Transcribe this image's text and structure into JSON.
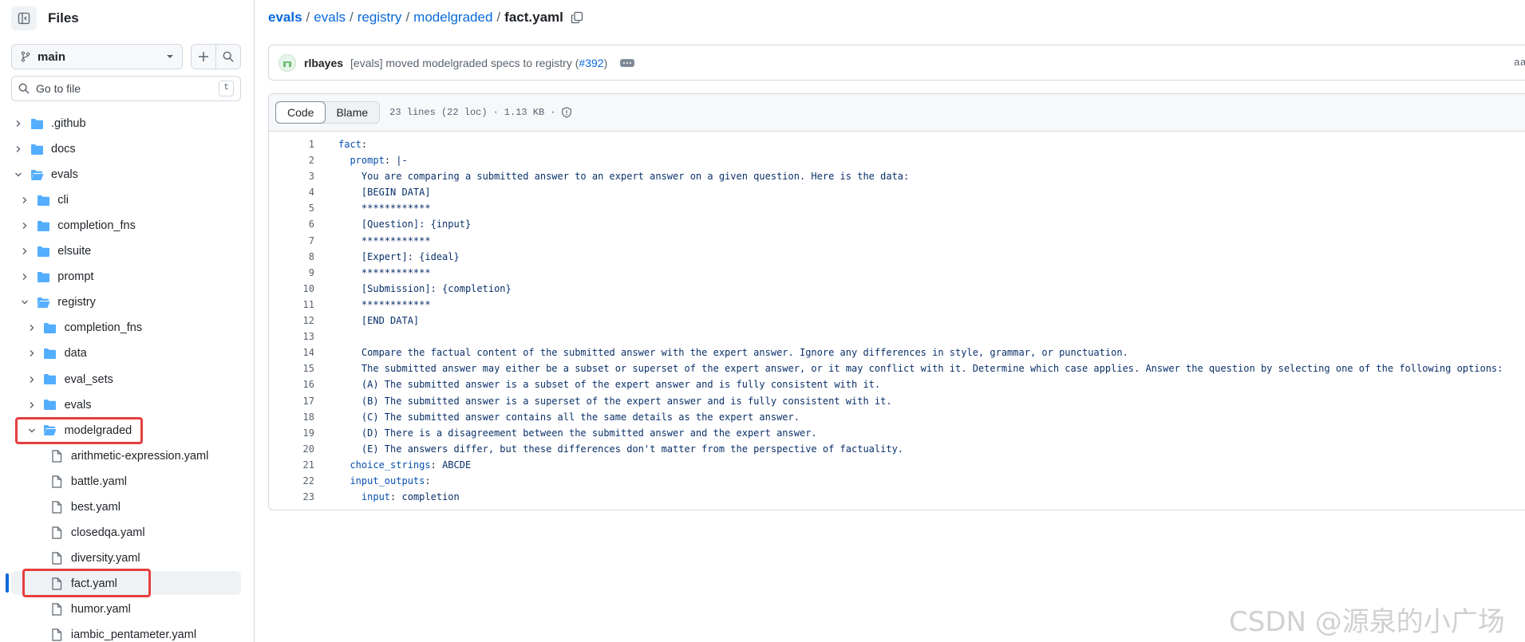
{
  "sidebar": {
    "title": "Files",
    "branch": "main",
    "goto_placeholder": "Go to file",
    "goto_shortcut": "t",
    "tree": [
      {
        "label": ".github",
        "type": "folder",
        "expanded": false,
        "depth": 0
      },
      {
        "label": "docs",
        "type": "folder",
        "expanded": false,
        "depth": 0
      },
      {
        "label": "evals",
        "type": "folder",
        "expanded": true,
        "depth": 0
      },
      {
        "label": "cli",
        "type": "folder",
        "expanded": false,
        "depth": 1
      },
      {
        "label": "completion_fns",
        "type": "folder",
        "expanded": false,
        "depth": 1
      },
      {
        "label": "elsuite",
        "type": "folder",
        "expanded": false,
        "depth": 1
      },
      {
        "label": "prompt",
        "type": "folder",
        "expanded": false,
        "depth": 1
      },
      {
        "label": "registry",
        "type": "folder",
        "expanded": true,
        "depth": 1
      },
      {
        "label": "completion_fns",
        "type": "folder",
        "expanded": false,
        "depth": 2
      },
      {
        "label": "data",
        "type": "folder",
        "expanded": false,
        "depth": 2
      },
      {
        "label": "eval_sets",
        "type": "folder",
        "expanded": false,
        "depth": 2
      },
      {
        "label": "evals",
        "type": "folder",
        "expanded": false,
        "depth": 2
      },
      {
        "label": "modelgraded",
        "type": "folder",
        "expanded": true,
        "depth": 2
      },
      {
        "label": "arithmetic-expression.yaml",
        "type": "file",
        "depth": 3
      },
      {
        "label": "battle.yaml",
        "type": "file",
        "depth": 3
      },
      {
        "label": "best.yaml",
        "type": "file",
        "depth": 3
      },
      {
        "label": "closedqa.yaml",
        "type": "file",
        "depth": 3
      },
      {
        "label": "diversity.yaml",
        "type": "file",
        "depth": 3
      },
      {
        "label": "fact.yaml",
        "type": "file",
        "depth": 3,
        "selected": true
      },
      {
        "label": "humor.yaml",
        "type": "file",
        "depth": 3
      },
      {
        "label": "iambic_pentameter.yaml",
        "type": "file",
        "depth": 3
      }
    ]
  },
  "breadcrumb": {
    "items": [
      "evals",
      "evals",
      "registry",
      "modelgraded"
    ],
    "current": "fact.yaml"
  },
  "commit": {
    "author": "rlbayes",
    "message_prefix": "[evals] moved modelgraded specs to registry (",
    "pr_link": "#392",
    "message_suffix": ")",
    "sha_partial": "aa"
  },
  "file": {
    "tabs": [
      "Code",
      "Blame"
    ],
    "active_tab": "Code",
    "lines_info": "23 lines (22 loc)",
    "size": "1.13 KB",
    "lines": [
      "fact:",
      "  prompt: |-",
      "    You are comparing a submitted answer to an expert answer on a given question. Here is the data:",
      "    [BEGIN DATA]",
      "    ************",
      "    [Question]: {input}",
      "    ************",
      "    [Expert]: {ideal}",
      "    ************",
      "    [Submission]: {completion}",
      "    ************",
      "    [END DATA]",
      "",
      "    Compare the factual content of the submitted answer with the expert answer. Ignore any differences in style, grammar, or punctuation.",
      "    The submitted answer may either be a subset or superset of the expert answer, or it may conflict with it. Determine which case applies. Answer the question by selecting one of the following options:",
      "    (A) The submitted answer is a subset of the expert answer and is fully consistent with it.",
      "    (B) The submitted answer is a superset of the expert answer and is fully consistent with it.",
      "    (C) The submitted answer contains all the same details as the expert answer.",
      "    (D) There is a disagreement between the submitted answer and the expert answer.",
      "    (E) The answers differ, but these differences don't matter from the perspective of factuality.",
      "  choice_strings: ABCDE",
      "  input_outputs:",
      "    input: completion"
    ]
  },
  "watermark": "CSDN @源泉的小广场",
  "colors": {
    "link": "#0969da",
    "folder": "#54aeff",
    "highlight_box": "#e53e3e",
    "yaml_key": "#0550ae",
    "yaml_string": "#0a3069"
  }
}
